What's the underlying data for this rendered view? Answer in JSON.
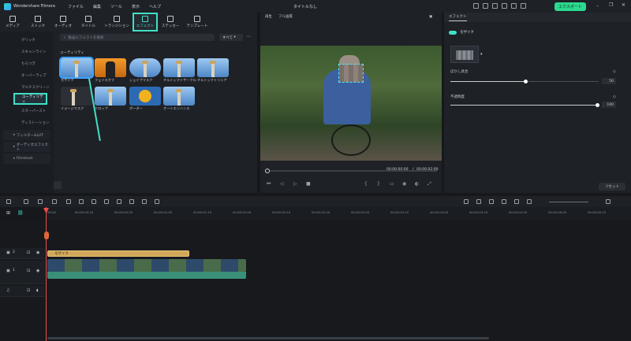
{
  "app": {
    "name": "Wondershare Filmora",
    "title": "タイトルなし",
    "menu": [
      "ファイル",
      "編集",
      "ツール",
      "表示",
      "ヘルプ"
    ],
    "export_label": "エクスポート"
  },
  "toolbar": {
    "tabs": [
      {
        "label": "メディア",
        "icon": "media-icon"
      },
      {
        "label": "ストック",
        "icon": "stock-icon"
      },
      {
        "label": "オーディオ",
        "icon": "music-icon"
      },
      {
        "label": "タイトル",
        "icon": "title-icon"
      },
      {
        "label": "トランジション",
        "icon": "transition-icon"
      },
      {
        "label": "エフェクト",
        "icon": "effect-icon",
        "active": true
      },
      {
        "label": "ステッカー",
        "icon": "sticker-icon"
      },
      {
        "label": "テンプレート",
        "icon": "template-icon"
      }
    ]
  },
  "sidebar": {
    "items": [
      "グリッチ",
      "スキャンライン",
      "ちらつき",
      "オーバーラップ",
      "マルチスクリーン",
      "ユーティリティ",
      "スターバースト",
      "ディストーション"
    ],
    "active": "ユーティリティ",
    "categories": [
      "フィルター&LUT",
      "オーディオエフェクト",
      "Filmstock"
    ]
  },
  "effects": {
    "search_placeholder": "動画エフェクトを検索",
    "filter_label": "すべて",
    "section_label": "ユーティリティ",
    "items": [
      {
        "name": "モザイク",
        "selected": true
      },
      {
        "name": "フェイスオフ"
      },
      {
        "name": "シェイプマスク"
      },
      {
        "name": "チルトシフトサークル"
      },
      {
        "name": "チルトシフトリニア"
      },
      {
        "name": "イメージマスク"
      },
      {
        "name": "クロップ"
      },
      {
        "name": "ボーダー"
      },
      {
        "name": "オートエンハンス"
      }
    ]
  },
  "preview": {
    "mode_label": "再生",
    "quality_label": "フル画質",
    "current_time": "00:00:00:00",
    "separator": "/",
    "total_time": "00:00:02:00"
  },
  "props": {
    "tab_label": "エフェクト",
    "effect_name": "モザイク",
    "blur_label": "ぼかし具合",
    "blur_value": "50",
    "opacity_label": "不透明度",
    "opacity_value": "100",
    "reset_label": "リセット"
  },
  "timeline": {
    "ruler": [
      "00:00",
      "00:00:00:10",
      "00:00:00:20",
      "00:00:01:05",
      "00:00:01:15",
      "00:00:02:00",
      "00:00:02:10",
      "00:00:02:20",
      "00:00:03:05",
      "00:00:03:15",
      "00:00:04:00",
      "00:00:04:10",
      "00:00:04:20",
      "00:00:05:05",
      "00:00:05:15"
    ],
    "effect_clip_label": "モザイク",
    "video_track_index": "1",
    "effect_track_index": "2"
  }
}
